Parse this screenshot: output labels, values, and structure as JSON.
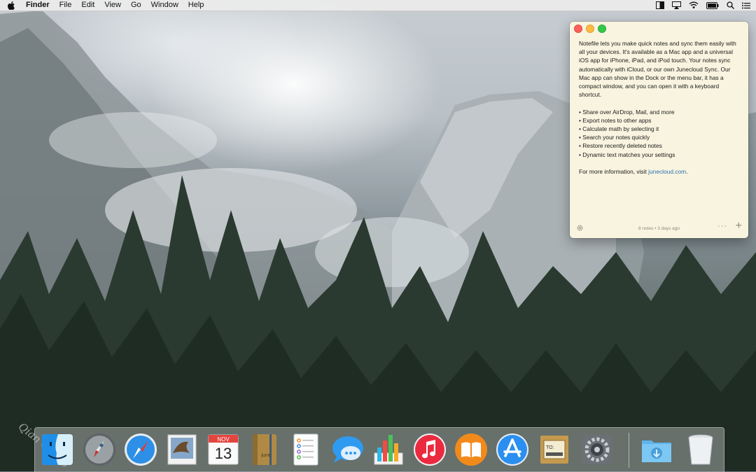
{
  "menubar": {
    "app_name": "Finder",
    "items": [
      "File",
      "Edit",
      "View",
      "Go",
      "Window",
      "Help"
    ],
    "status_icons": [
      "split-view-icon",
      "airplay-icon",
      "wifi-icon",
      "battery-icon",
      "spotlight-icon",
      "notification-center-icon"
    ]
  },
  "note": {
    "paragraph1": "Notefile lets you make quick notes and sync them easily with all your devices. It's available as a Mac app and a universal iOS app for iPhone, iPad, and iPod touch. Your notes sync automatically with iCloud, or our own Junecloud Sync. Our Mac app can show in the Dock or the menu bar, it has a compact window, and you can open it with a keyboard shortcut.",
    "bullets": [
      "• Share over AirDrop, Mail, and more",
      "• Export notes to other apps",
      "• Calculate math by selecting it",
      "• Search your notes quickly",
      "• Restore recently deleted notes",
      "• Dynamic text matches your settings"
    ],
    "info_prefix": "For more information, visit ",
    "info_link": "junecloud.com",
    "info_suffix": ".",
    "footer_status": "8 notes • 3 days ago",
    "more_label": "···",
    "add_label": "+"
  },
  "dock": {
    "items": [
      "finder-icon",
      "launchpad-icon",
      "safari-icon",
      "mail-icon",
      "calendar-icon",
      "notefile-icon",
      "reminders-icon",
      "messages-icon",
      "numbers-icon",
      "itunes-icon",
      "ibooks-icon",
      "app-store-icon",
      "notefile-ticket-icon",
      "system-preferences-icon",
      "downloads-folder-icon",
      "trash-icon"
    ],
    "calendar_month": "NOV",
    "calendar_day": "13",
    "notefile_label": "june",
    "ticket_label": "TO:"
  },
  "watermark": "Qian Cheng"
}
